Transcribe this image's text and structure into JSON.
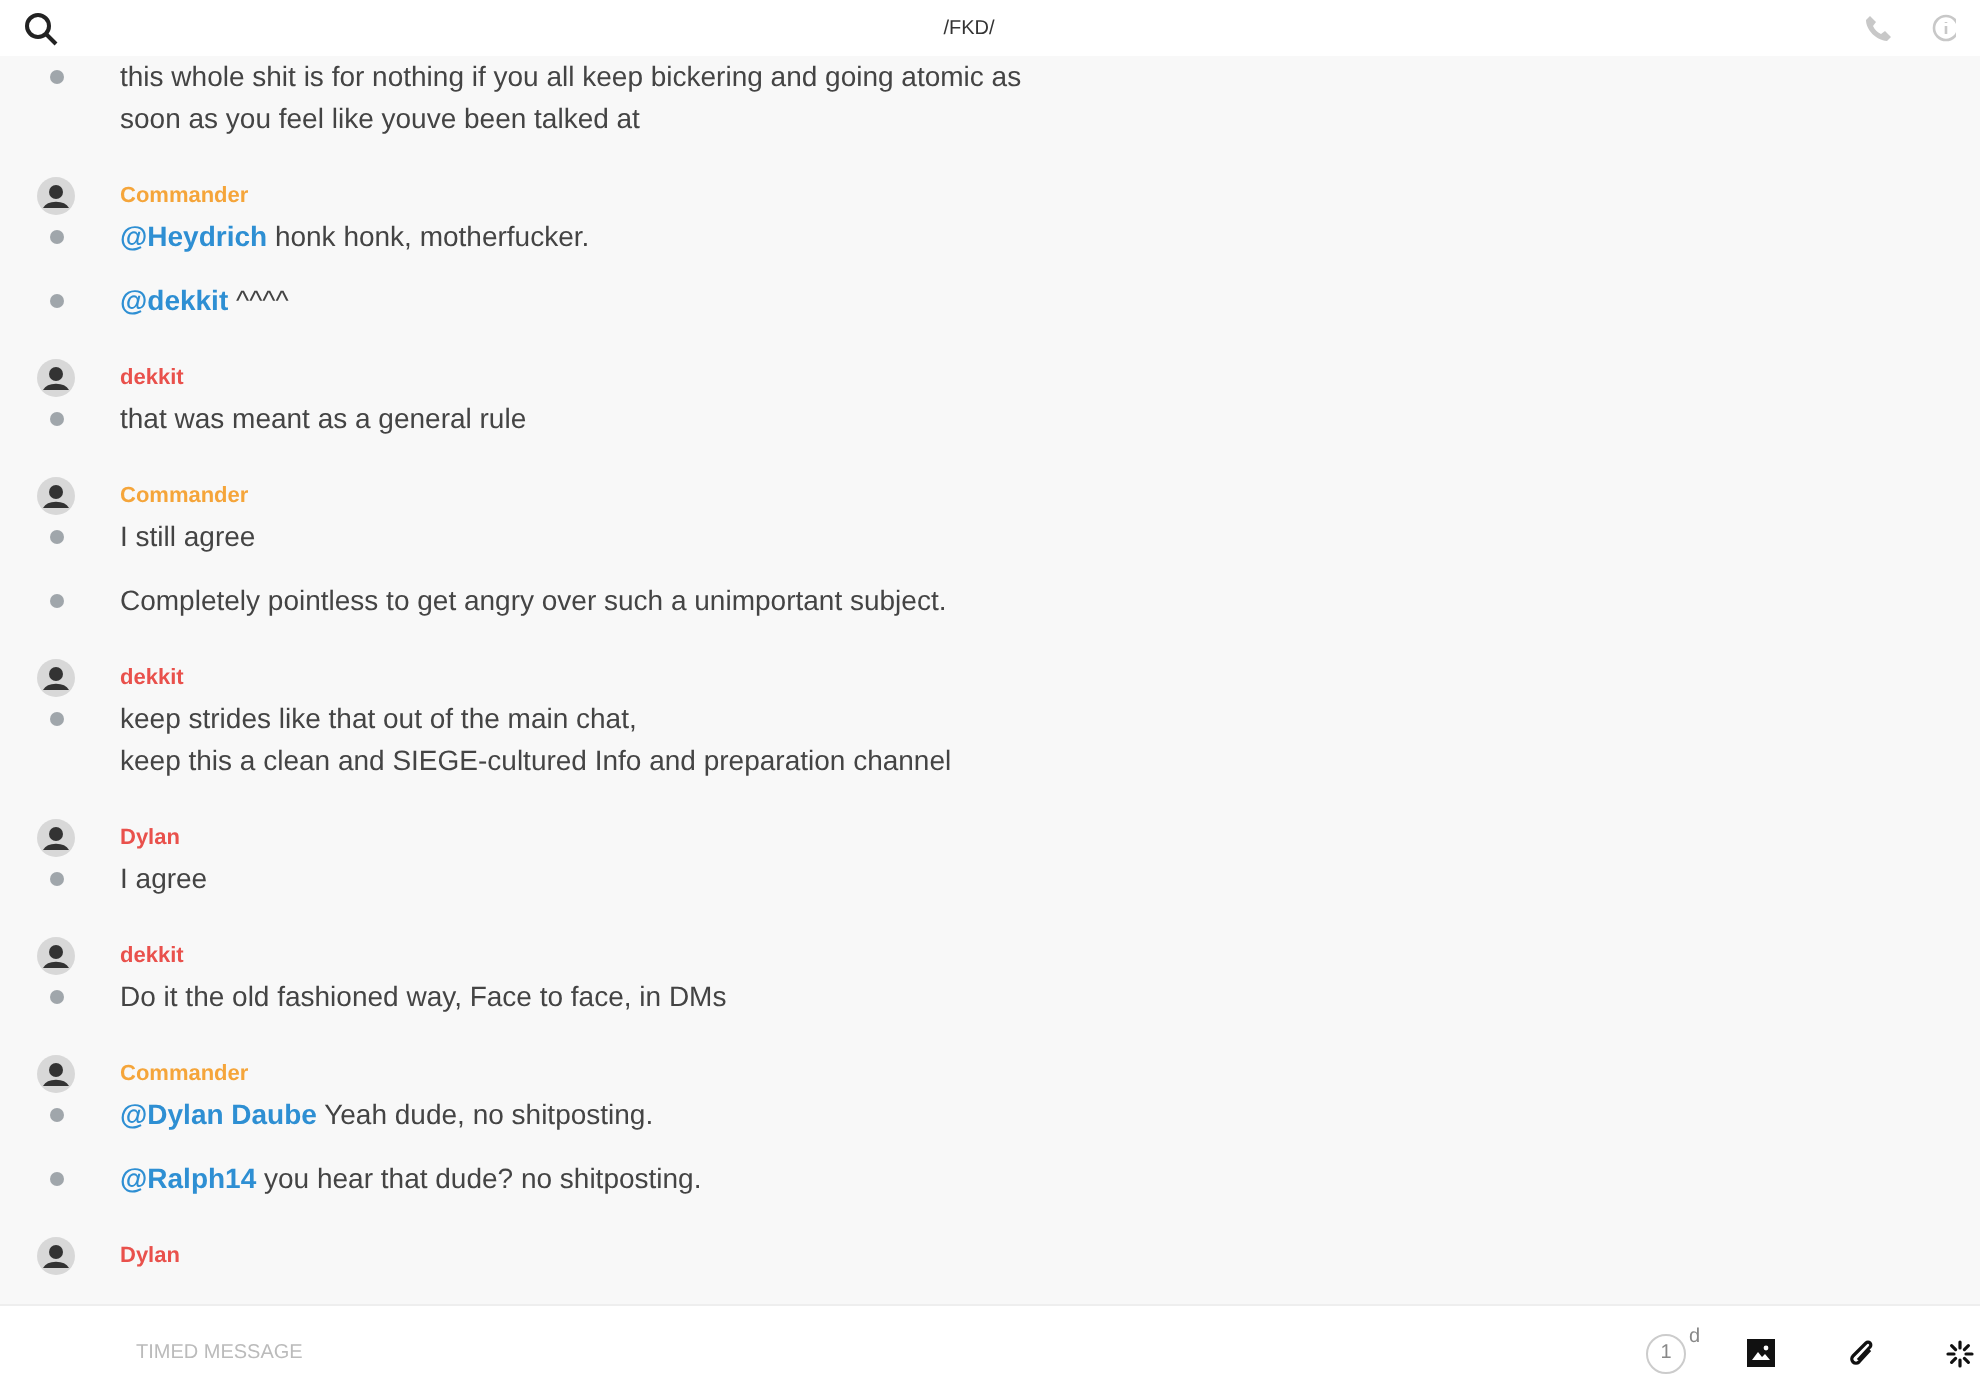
{
  "header": {
    "title": "/FKD/"
  },
  "groups": [
    {
      "messages": [
        {
          "lines": [
            {
              "text": "this whole shit is for nothing if you all keep bickering and going atomic as"
            },
            {
              "text": "soon as you feel like youve been talked at"
            }
          ]
        }
      ]
    },
    {
      "author": "Commander",
      "color": "#f5a53a",
      "messages": [
        {
          "lines": [
            {
              "mention": "@Heydrich",
              "text": " honk honk, motherfucker."
            }
          ]
        },
        {
          "lines": [
            {
              "mention": "@dekkit",
              "text": " ^^^^"
            }
          ]
        }
      ]
    },
    {
      "author": "dekkit",
      "color": "#e9514c",
      "messages": [
        {
          "lines": [
            {
              "text": "that was meant as a general rule"
            }
          ]
        }
      ]
    },
    {
      "author": "Commander",
      "color": "#f5a53a",
      "messages": [
        {
          "lines": [
            {
              "text": "I still agree"
            }
          ]
        },
        {
          "lines": [
            {
              "text": "Completely pointless to get angry over such a unimportant subject."
            }
          ]
        }
      ]
    },
    {
      "author": "dekkit",
      "color": "#e9514c",
      "messages": [
        {
          "lines": [
            {
              "text": "keep strides like that out of the main chat,"
            },
            {
              "text": "keep this a clean and SIEGE-cultured Info and preparation channel"
            }
          ]
        }
      ]
    },
    {
      "author": "Dylan",
      "color": "#e9514c",
      "messages": [
        {
          "lines": [
            {
              "text": "I agree"
            }
          ]
        }
      ]
    },
    {
      "author": "dekkit",
      "color": "#e9514c",
      "messages": [
        {
          "lines": [
            {
              "text": "Do it the old fashioned way, Face to face, in DMs"
            }
          ]
        }
      ]
    },
    {
      "author": "Commander",
      "color": "#f5a53a",
      "messages": [
        {
          "lines": [
            {
              "mention": "@Dylan Daube",
              "text": " Yeah dude, no shitposting."
            }
          ]
        },
        {
          "lines": [
            {
              "mention": "@Ralph14",
              "text": " you hear that dude? no shitposting."
            }
          ]
        }
      ]
    },
    {
      "author": "Dylan",
      "color": "#e9514c"
    }
  ],
  "composer": {
    "placeholder": "TIMED MESSAGE",
    "timer_value": "1",
    "timer_unit": "d"
  }
}
